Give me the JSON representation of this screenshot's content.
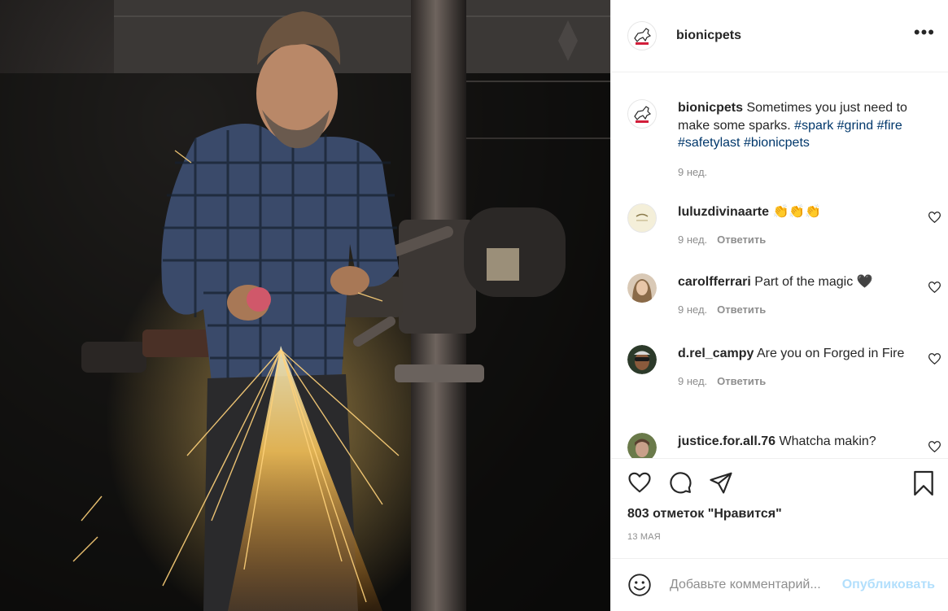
{
  "post": {
    "author": "bionicpets",
    "avatar_text": "BIONIC PETS",
    "more_label": "•••",
    "caption": {
      "text": "Sometimes you just need to make some sparks.",
      "hashtags": [
        "#spark",
        "#grind",
        "#fire",
        "#safetylast",
        "#bionicpets"
      ],
      "age": "9 нед."
    },
    "comments": [
      {
        "user": "luluzdivinaarte",
        "text": "👏👏👏",
        "age": "9 нед.",
        "reply_label": "Ответить"
      },
      {
        "user": "carolfferrari",
        "text": "Part of the magic 🖤",
        "age": "9 нед.",
        "reply_label": "Ответить"
      },
      {
        "user": "d.rel_campy",
        "text": "Are you on Forged in Fire",
        "age": "9 нед.",
        "reply_label": "Ответить"
      },
      {
        "user": "justice.for.all.76",
        "text": "Whatcha makin?"
      }
    ],
    "likes": "803 отметок \"Нравится\"",
    "date": "13 МАЯ",
    "add_comment": {
      "placeholder": "Добавьте комментарий...",
      "publish_label": "Опубликовать"
    }
  },
  "icons": {
    "header_more": "more-horizontal-icon",
    "like": "heart-icon",
    "comment": "comment-bubble-icon",
    "share": "paper-plane-icon",
    "save": "bookmark-icon",
    "emoji": "smiley-icon"
  },
  "colors": {
    "text": "#262626",
    "secondary": "#8e8e8e",
    "link": "#00376b",
    "publish_disabled": "#b2dffc",
    "divider": "#efefef"
  }
}
